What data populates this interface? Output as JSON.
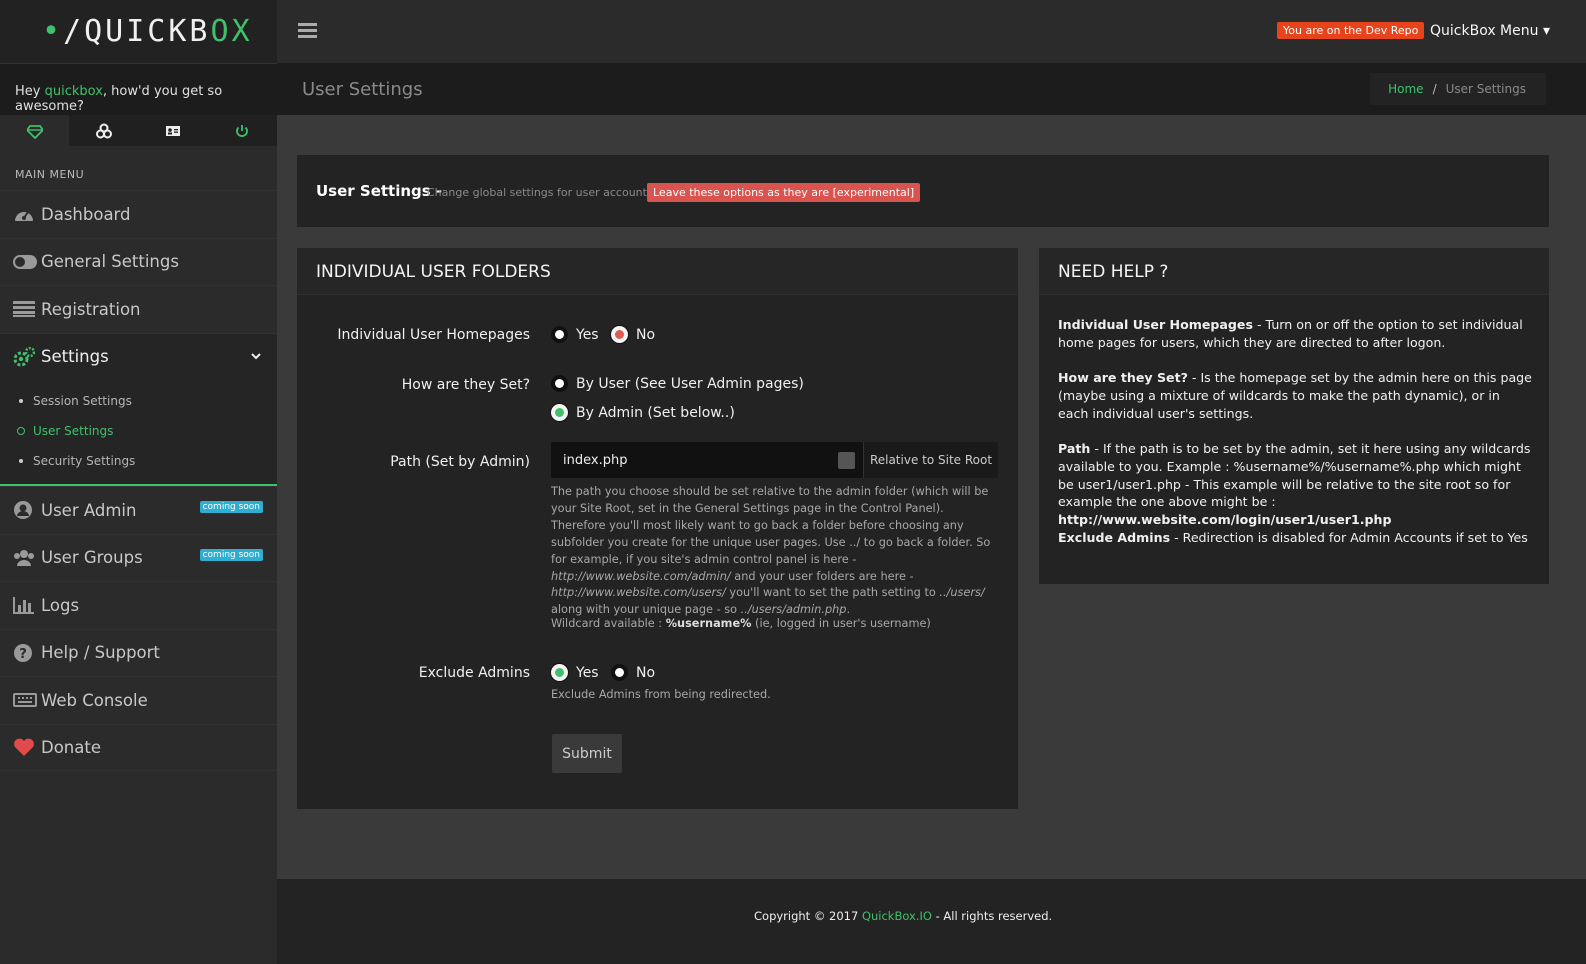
{
  "logo": {
    "part1": "•/QUICKB",
    "part2": "O",
    "part3": "X"
  },
  "greeting": {
    "prefix": "Hey ",
    "user": "quickbox",
    "suffix": ", how'd you get so awesome?"
  },
  "icon_tabs": [
    "diamond-icon",
    "biohazard-icon",
    "id-card-icon",
    "power-icon"
  ],
  "sidebar": {
    "menu_title": "MAIN MENU",
    "items": [
      {
        "label": "Dashboard",
        "icon": "dashboard-icon"
      },
      {
        "label": "General Settings",
        "icon": "toggle-icon"
      },
      {
        "label": "Registration",
        "icon": "registration-icon"
      },
      {
        "label": "Settings",
        "icon": "gears-icon"
      },
      {
        "label": "User Admin",
        "icon": "user-circle-icon",
        "badge": "coming soon"
      },
      {
        "label": "User Groups",
        "icon": "users-icon",
        "badge": "coming soon"
      },
      {
        "label": "Logs",
        "icon": "bar-chart-icon"
      },
      {
        "label": "Help / Support",
        "icon": "question-icon"
      },
      {
        "label": "Web Console",
        "icon": "keyboard-icon"
      },
      {
        "label": "Donate",
        "icon": "heart-icon"
      }
    ],
    "submenu": [
      "Session Settings",
      "User Settings",
      "Security Settings"
    ]
  },
  "topbar": {
    "dev_badge": "You are on the Dev Repo",
    "menu_label": "QuickBox Menu ▾"
  },
  "page": {
    "title": "User Settings"
  },
  "breadcrumb": {
    "home": "Home",
    "sep": "/",
    "current": "User Settings"
  },
  "settings_head": {
    "title": "User Settings -",
    "desc": "Change global settings for user accounts.",
    "warning": "Leave these options as they are [experimental]"
  },
  "form": {
    "heading": "INDIVIDUAL USER FOLDERS",
    "homepages_label": "Individual User Homepages",
    "yes": "Yes",
    "no": "No",
    "how_label": "How are they Set?",
    "by_user": "By User (See User Admin pages)",
    "by_admin": "By Admin (Set below..)",
    "path_label": "Path (Set by Admin)",
    "path_value": "index.php",
    "path_addon": "Relative to Site Root",
    "path_help_1": "The path you choose should be set relative to the admin folder (which will be your Site Root, set in the General Settings page in the Control Panel). Therefore you'll most likely want to go back a folder before choosing any subfolder you create for the unique user pages. Use ../ to go back a folder. So for example, if you site's admin control panel is here - ",
    "path_help_url1": "http://www.website.com/admin/",
    "path_help_2": " and your user folders are here - ",
    "path_help_url2": "http://www.website.com/users/",
    "path_help_3": " you'll want to set the path setting to ",
    "path_help_rel1": "../users/",
    "path_help_4": " along with your unique page - so ",
    "path_help_rel2": "../users/admin.php",
    "path_help_5": ".",
    "wildcard_prefix": "Wildcard available : ",
    "wildcard_name": "%username%",
    "wildcard_suffix": " (ie, logged in user's username)",
    "exclude_label": "Exclude Admins",
    "exclude_help": "Exclude Admins from being redirected.",
    "submit": "Submit",
    "state": {
      "homepages": "No",
      "how": "By Admin",
      "exclude": "Yes"
    }
  },
  "help": {
    "heading": "NEED HELP ?",
    "p1_title": "Individual User Homepages",
    "p1_text": " - Turn on or off the option to set individual home pages for users, which they are directed to after logon.",
    "p2_title": "How are they Set?",
    "p2_text": " - Is the homepage set by the admin here on this page (maybe using a mixture of wildcards to make the path dynamic), or in each individual user's settings.",
    "p3_title": "Path",
    "p3_text": " - If the path is to be set by the admin, set it here using any wildcards available to you. Example : %username%/%username%.php which might be user1/user1.php - This example will be relative to the site root so for example the one above might be : ",
    "p3_url": "http://www.website.com/login/user1/user1.php",
    "p4_title": "Exclude Admins",
    "p4_text": " - Redirection is disabled for Admin Accounts if set to Yes"
  },
  "footer": {
    "prefix": "Copyright © 2017 ",
    "link": "QuickBox.IO",
    "suffix": " - All rights reserved."
  },
  "colors": {
    "accent": "#3ec16a",
    "warning": "#d9534f",
    "dev_badge": "#e8441b",
    "badge": "#2eaed3"
  }
}
